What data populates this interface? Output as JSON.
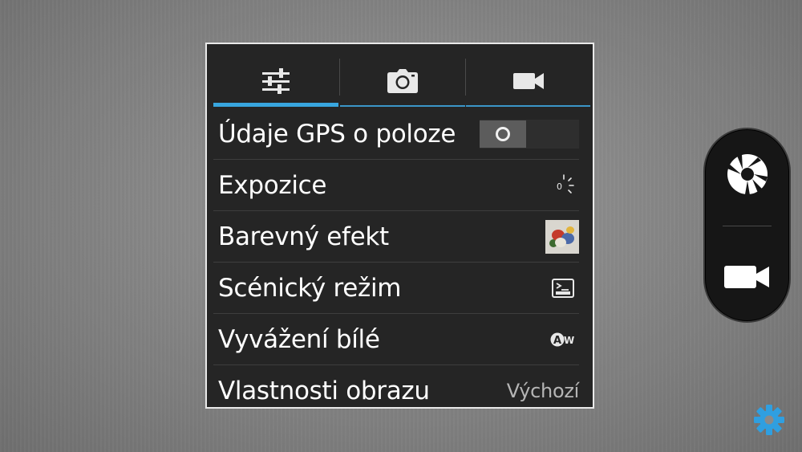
{
  "settings_panel": {
    "tabs": [
      {
        "icon": "sliders-icon",
        "active": true
      },
      {
        "icon": "camera-icon",
        "active": false
      },
      {
        "icon": "video-camera-icon",
        "active": false
      }
    ],
    "rows": [
      {
        "label": "Údaje GPS o poloze",
        "indicator": "toggle",
        "toggle_on": false
      },
      {
        "label": "Expozice",
        "indicator": "exposure-icon",
        "exposure_value": "0"
      },
      {
        "label": "Barevný efekt",
        "indicator": "color-effect-thumbnail"
      },
      {
        "label": "Scénický režim",
        "indicator": "scene-mode-icon"
      },
      {
        "label": "Vyvážení bílé",
        "indicator": "auto-white-balance-icon",
        "awb_text": "AW"
      },
      {
        "label": "Vlastnosti obrazu",
        "indicator": "value",
        "value": "Výchozí"
      }
    ]
  },
  "controls": {
    "shutter": "shutter-icon",
    "video": "video-camera-icon",
    "settings": "gear-icon"
  },
  "colors": {
    "accent": "#38a6df",
    "panel_bg": "#252525",
    "panel_border": "#e9e9e9",
    "settings_icon": "#2f9fe0",
    "value_text": "#b5b5b5"
  }
}
